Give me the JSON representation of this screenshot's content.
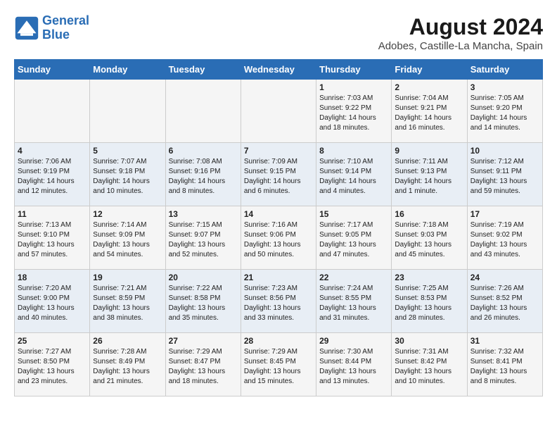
{
  "logo": {
    "line1": "General",
    "line2": "Blue"
  },
  "title": "August 2024",
  "subtitle": "Adobes, Castille-La Mancha, Spain",
  "weekdays": [
    "Sunday",
    "Monday",
    "Tuesday",
    "Wednesday",
    "Thursday",
    "Friday",
    "Saturday"
  ],
  "weeks": [
    [
      {
        "day": "",
        "info": ""
      },
      {
        "day": "",
        "info": ""
      },
      {
        "day": "",
        "info": ""
      },
      {
        "day": "",
        "info": ""
      },
      {
        "day": "1",
        "info": "Sunrise: 7:03 AM\nSunset: 9:22 PM\nDaylight: 14 hours\nand 18 minutes."
      },
      {
        "day": "2",
        "info": "Sunrise: 7:04 AM\nSunset: 9:21 PM\nDaylight: 14 hours\nand 16 minutes."
      },
      {
        "day": "3",
        "info": "Sunrise: 7:05 AM\nSunset: 9:20 PM\nDaylight: 14 hours\nand 14 minutes."
      }
    ],
    [
      {
        "day": "4",
        "info": "Sunrise: 7:06 AM\nSunset: 9:19 PM\nDaylight: 14 hours\nand 12 minutes."
      },
      {
        "day": "5",
        "info": "Sunrise: 7:07 AM\nSunset: 9:18 PM\nDaylight: 14 hours\nand 10 minutes."
      },
      {
        "day": "6",
        "info": "Sunrise: 7:08 AM\nSunset: 9:16 PM\nDaylight: 14 hours\nand 8 minutes."
      },
      {
        "day": "7",
        "info": "Sunrise: 7:09 AM\nSunset: 9:15 PM\nDaylight: 14 hours\nand 6 minutes."
      },
      {
        "day": "8",
        "info": "Sunrise: 7:10 AM\nSunset: 9:14 PM\nDaylight: 14 hours\nand 4 minutes."
      },
      {
        "day": "9",
        "info": "Sunrise: 7:11 AM\nSunset: 9:13 PM\nDaylight: 14 hours\nand 1 minute."
      },
      {
        "day": "10",
        "info": "Sunrise: 7:12 AM\nSunset: 9:11 PM\nDaylight: 13 hours\nand 59 minutes."
      }
    ],
    [
      {
        "day": "11",
        "info": "Sunrise: 7:13 AM\nSunset: 9:10 PM\nDaylight: 13 hours\nand 57 minutes."
      },
      {
        "day": "12",
        "info": "Sunrise: 7:14 AM\nSunset: 9:09 PM\nDaylight: 13 hours\nand 54 minutes."
      },
      {
        "day": "13",
        "info": "Sunrise: 7:15 AM\nSunset: 9:07 PM\nDaylight: 13 hours\nand 52 minutes."
      },
      {
        "day": "14",
        "info": "Sunrise: 7:16 AM\nSunset: 9:06 PM\nDaylight: 13 hours\nand 50 minutes."
      },
      {
        "day": "15",
        "info": "Sunrise: 7:17 AM\nSunset: 9:05 PM\nDaylight: 13 hours\nand 47 minutes."
      },
      {
        "day": "16",
        "info": "Sunrise: 7:18 AM\nSunset: 9:03 PM\nDaylight: 13 hours\nand 45 minutes."
      },
      {
        "day": "17",
        "info": "Sunrise: 7:19 AM\nSunset: 9:02 PM\nDaylight: 13 hours\nand 43 minutes."
      }
    ],
    [
      {
        "day": "18",
        "info": "Sunrise: 7:20 AM\nSunset: 9:00 PM\nDaylight: 13 hours\nand 40 minutes."
      },
      {
        "day": "19",
        "info": "Sunrise: 7:21 AM\nSunset: 8:59 PM\nDaylight: 13 hours\nand 38 minutes."
      },
      {
        "day": "20",
        "info": "Sunrise: 7:22 AM\nSunset: 8:58 PM\nDaylight: 13 hours\nand 35 minutes."
      },
      {
        "day": "21",
        "info": "Sunrise: 7:23 AM\nSunset: 8:56 PM\nDaylight: 13 hours\nand 33 minutes."
      },
      {
        "day": "22",
        "info": "Sunrise: 7:24 AM\nSunset: 8:55 PM\nDaylight: 13 hours\nand 31 minutes."
      },
      {
        "day": "23",
        "info": "Sunrise: 7:25 AM\nSunset: 8:53 PM\nDaylight: 13 hours\nand 28 minutes."
      },
      {
        "day": "24",
        "info": "Sunrise: 7:26 AM\nSunset: 8:52 PM\nDaylight: 13 hours\nand 26 minutes."
      }
    ],
    [
      {
        "day": "25",
        "info": "Sunrise: 7:27 AM\nSunset: 8:50 PM\nDaylight: 13 hours\nand 23 minutes."
      },
      {
        "day": "26",
        "info": "Sunrise: 7:28 AM\nSunset: 8:49 PM\nDaylight: 13 hours\nand 21 minutes."
      },
      {
        "day": "27",
        "info": "Sunrise: 7:29 AM\nSunset: 8:47 PM\nDaylight: 13 hours\nand 18 minutes."
      },
      {
        "day": "28",
        "info": "Sunrise: 7:29 AM\nSunset: 8:45 PM\nDaylight: 13 hours\nand 15 minutes."
      },
      {
        "day": "29",
        "info": "Sunrise: 7:30 AM\nSunset: 8:44 PM\nDaylight: 13 hours\nand 13 minutes."
      },
      {
        "day": "30",
        "info": "Sunrise: 7:31 AM\nSunset: 8:42 PM\nDaylight: 13 hours\nand 10 minutes."
      },
      {
        "day": "31",
        "info": "Sunrise: 7:32 AM\nSunset: 8:41 PM\nDaylight: 13 hours\nand 8 minutes."
      }
    ]
  ]
}
